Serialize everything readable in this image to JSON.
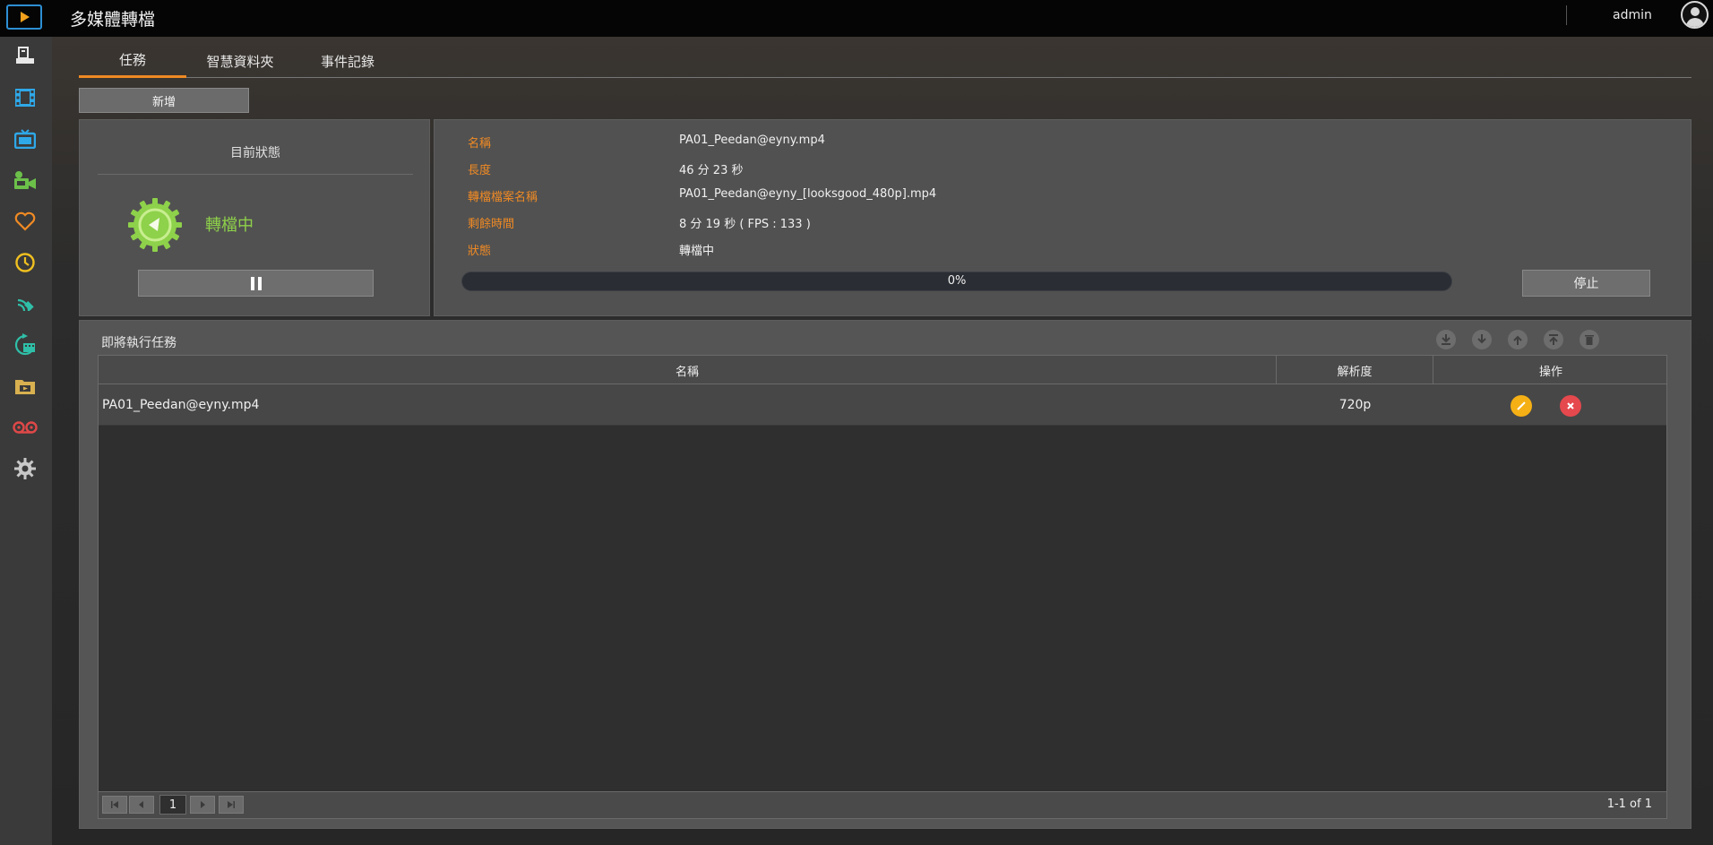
{
  "app": {
    "title": "多媒體轉檔",
    "user": "admin"
  },
  "sidebar": {
    "items": [
      {
        "icon": "nas-device-icon",
        "color": "#e8e8e8"
      },
      {
        "icon": "film-icon",
        "color": "#2fa8e8"
      },
      {
        "icon": "tv-icon",
        "color": "#2fa8e8"
      },
      {
        "icon": "camcorder-icon",
        "color": "#6cc04a"
      },
      {
        "icon": "heart-icon",
        "color": "#f08a24"
      },
      {
        "icon": "clock-icon",
        "color": "#f0c020"
      },
      {
        "icon": "satellite-icon",
        "color": "#2fbfa8"
      },
      {
        "icon": "transcode-icon",
        "color": "#2fbfa8"
      },
      {
        "icon": "folder-icon",
        "color": "#d8b050"
      },
      {
        "icon": "tape-icon",
        "color": "#e04848"
      },
      {
        "icon": "gear-icon",
        "color": "#c8c8c8"
      }
    ]
  },
  "tabs": [
    {
      "label": "任務",
      "active": true
    },
    {
      "label": "智慧資料夾",
      "active": false
    },
    {
      "label": "事件記錄",
      "active": false
    }
  ],
  "toolbar": {
    "new_label": "新增"
  },
  "status": {
    "title": "目前狀態",
    "state": "轉檔中",
    "state_color": "#8ed14a"
  },
  "info": {
    "name_label": "名稱",
    "name_value": "PA01_Peedan@eyny.mp4",
    "duration_label": "長度",
    "duration_value": "46 分 23 秒",
    "output_label": "轉檔檔案名稱",
    "output_value": "PA01_Peedan@eyny_[looksgood_480p].mp4",
    "remaining_label": "剩餘時間",
    "remaining_value": "8 分 19 秒 ( FPS : 133 )",
    "state_label": "狀態",
    "state_value": "轉檔中",
    "progress_text": "0%",
    "progress_fraction": 0.0,
    "stop_label": "停止"
  },
  "queue": {
    "title": "即將執行任務",
    "tools": [
      "download-bottom-icon",
      "move-down-icon",
      "move-up-icon",
      "move-top-icon",
      "delete-icon"
    ],
    "columns": [
      "名稱",
      "解析度",
      "操作"
    ],
    "rows": [
      {
        "name": "PA01_Peedan@eyny.mp4",
        "resolution": "720p"
      }
    ],
    "pager": {
      "page": "1",
      "summary": "1-1 of 1"
    }
  },
  "colors": {
    "accent": "#f08a24",
    "edit": "#f5b015",
    "delete": "#e5484d"
  }
}
